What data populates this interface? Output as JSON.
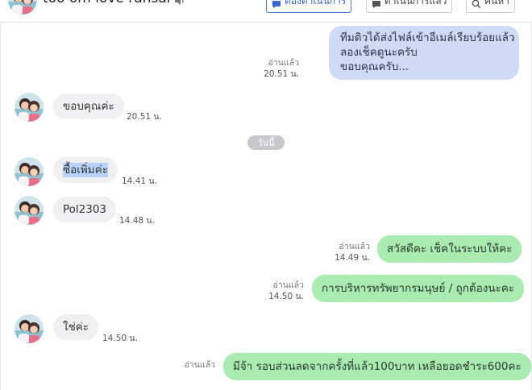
{
  "header": {
    "contact_name": "too om love ransai",
    "buttons": {
      "pending": "ต้องดำเนินการ",
      "done": "ดำเนินการแล้ว",
      "search": "ค้นหา"
    },
    "colors": {
      "accent": "#3b68d4"
    }
  },
  "chat": {
    "date_divider": "วันนี้",
    "read_label": "อ่านแล้ว",
    "messages": [
      {
        "side": "out",
        "text_lines": [
          "ทีมติวได้ส่งไฟล์เข้าอีเมล์เรียบร้อยแล้ว",
          "ลองเช็คดูนะครับ",
          "ขอบคุณครับ..."
        ],
        "time": "20.51 น.",
        "read": true
      },
      {
        "side": "in",
        "text": "ขอบคุณค่ะ",
        "time": "20.51 น."
      },
      {
        "side": "in",
        "text": "ซื้อเพิ่มค่ะ",
        "time": "14.41 น."
      },
      {
        "side": "in",
        "text": "Pol2303",
        "time": "14.48 น."
      },
      {
        "side": "out",
        "text": "สวัสดีคะ เช็คในระบบให้คะ",
        "time": "14.49 น.",
        "read": true
      },
      {
        "side": "out",
        "text": "การบริหารทรัพยากรมนุษย์ / ถูกต้องนะคะ",
        "time": "14.50 น.",
        "read": true
      },
      {
        "side": "in",
        "text": "ใช่ค่ะ",
        "time": "14.50 น."
      },
      {
        "side": "out",
        "text": "มีจ้า รอบส่วนลดจากครั้งที่แล้ว100บาท เหลือยอดชำระ600คะ",
        "read": true
      }
    ],
    "colors": {
      "incoming_bubble": "#f0f0f2",
      "outgoing_bubble": "#a9ebb0",
      "outgoing_bubble_alt": "#cfdbf5"
    }
  }
}
